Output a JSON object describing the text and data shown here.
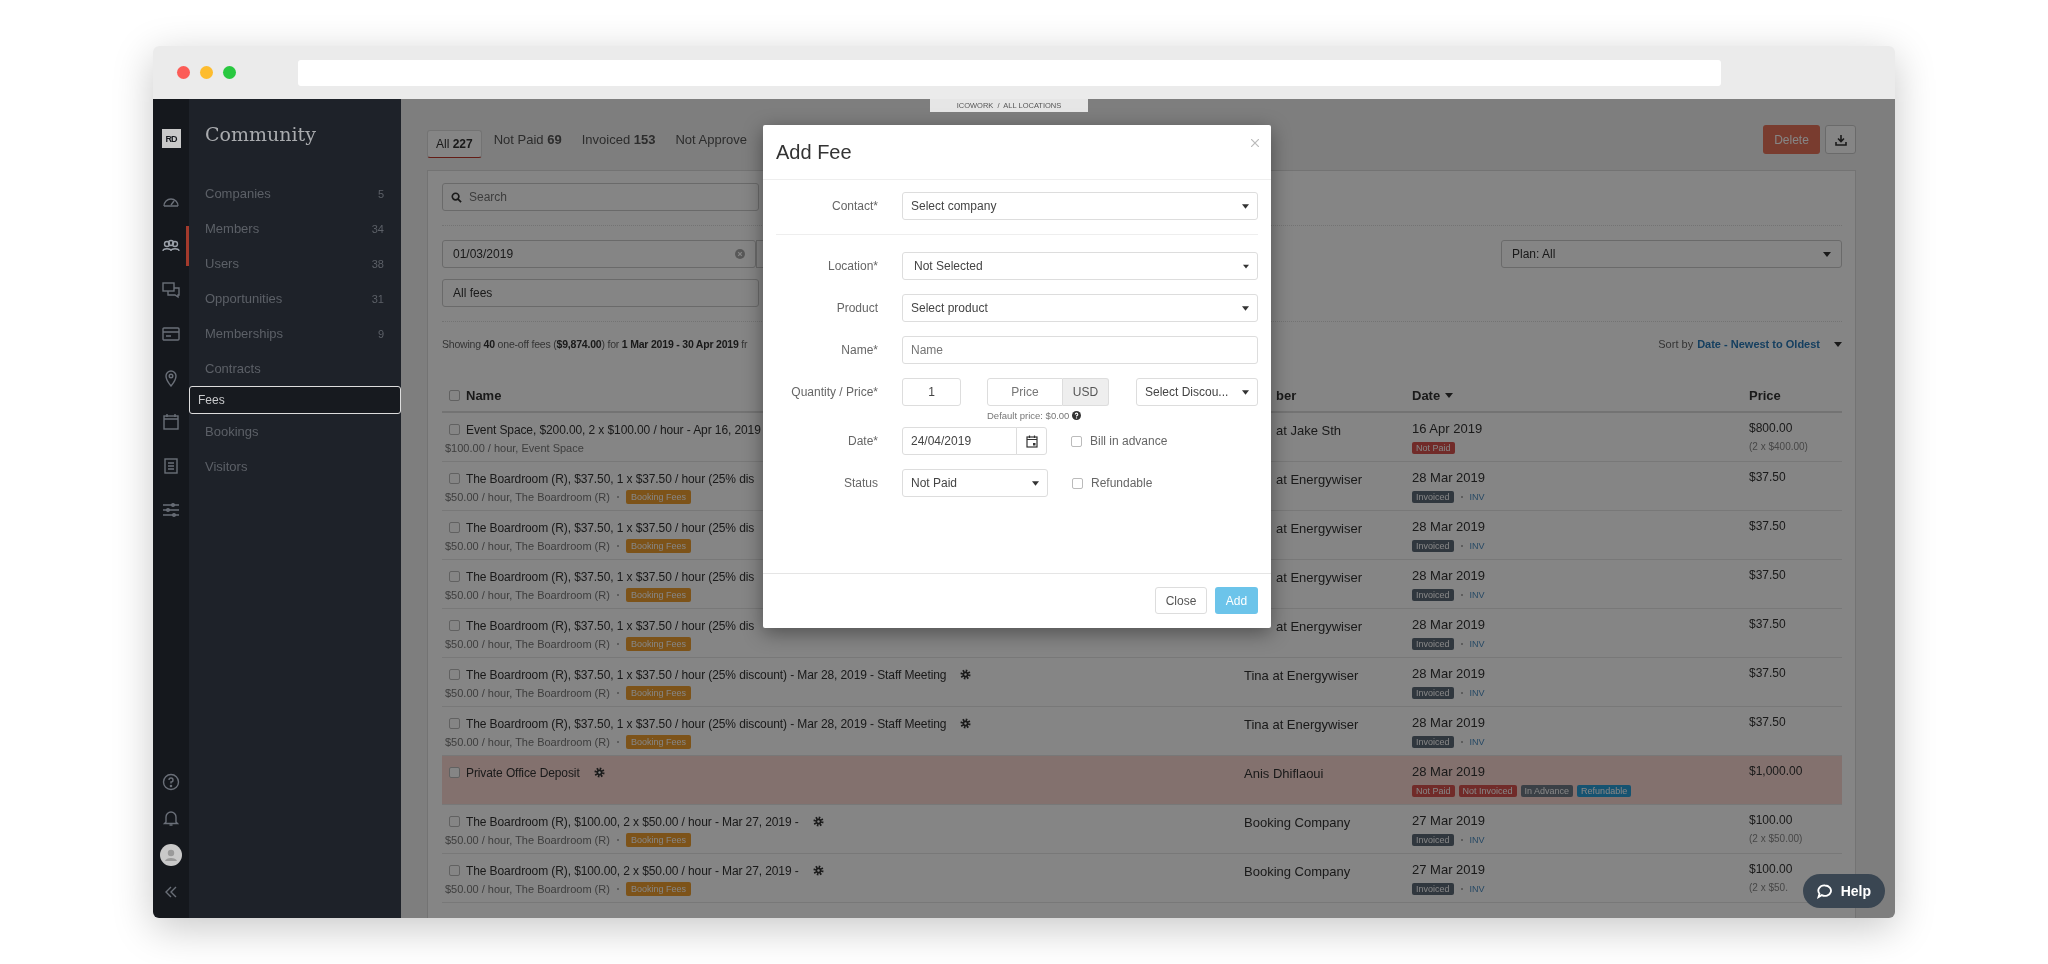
{
  "breadcrumb": "ICOWORK  /  ALL LOCATIONS",
  "rail": {
    "logo": "RD",
    "items": [
      {
        "kind": "gauge",
        "selected": false
      },
      {
        "kind": "people",
        "selected": true
      },
      {
        "kind": "chat",
        "selected": false
      },
      {
        "kind": "card",
        "selected": false
      },
      {
        "kind": "pin",
        "selected": false
      },
      {
        "kind": "calendar",
        "selected": false
      },
      {
        "kind": "document",
        "selected": false
      },
      {
        "kind": "sliders",
        "selected": false
      }
    ],
    "bottom": [
      {
        "kind": "help"
      },
      {
        "kind": "bell"
      },
      {
        "kind": "avatar"
      },
      {
        "kind": "collapse"
      }
    ]
  },
  "sidebar": {
    "title": "Community",
    "items": [
      {
        "label": "Companies",
        "count": "5",
        "selected": false
      },
      {
        "label": "Members",
        "count": "34",
        "selected": false
      },
      {
        "label": "Users",
        "count": "38",
        "selected": false
      },
      {
        "label": "Opportunities",
        "count": "31",
        "selected": false
      },
      {
        "label": "Memberships",
        "count": "9",
        "selected": false
      },
      {
        "label": "Contracts",
        "selected": false
      },
      {
        "label": "Fees",
        "selected": true
      },
      {
        "label": "Bookings",
        "selected": false
      },
      {
        "label": "Visitors",
        "selected": false
      }
    ]
  },
  "tabs": [
    {
      "label": "All",
      "count": "227",
      "selected": true
    },
    {
      "label": "Not Paid",
      "count": "69",
      "selected": false
    },
    {
      "label": "Invoiced",
      "count": "153",
      "selected": false
    },
    {
      "label": "Not Approve",
      "selected": false
    }
  ],
  "toolbar": {
    "delete": "Delete"
  },
  "filters": {
    "search": {
      "placeholder": "Search"
    },
    "date_from": {
      "value": "01/03/2019"
    },
    "fee_type": {
      "value": "All fees"
    },
    "plan": {
      "value": "Plan: All"
    }
  },
  "summary": "Showing **40** one-off fees (**$9,874.00**) for **1 Mar 2019 - 30 Apr 2019** fr",
  "sort": {
    "label": "Sort by",
    "value": "Date - Newest to Oldest"
  },
  "table": {
    "columns": [
      "Name",
      "ber",
      "Date",
      "Price"
    ],
    "all_checked": false,
    "rows": [
      {
        "name": "Event Space, $200.00, 2 x $100.00 / hour - Apr 16, 2019",
        "settings": false,
        "detail": "$100.00 / hour, Event Space",
        "checked": false,
        "highlighted": false,
        "member": "at Jake Sth",
        "date": "16 Apr 2019",
        "badges": [
          {
            "label": "Not Paid",
            "kind": "unpaid"
          }
        ],
        "price": "$800.00",
        "price_detail": "(2 x $400.00)"
      },
      {
        "name": "The Boardroom (R), $37.50, 1 x $37.50 / hour (25% dis",
        "settings": false,
        "detail": "$50.00 / hour, The Boardroom (R)",
        "tag": "Booking Fees",
        "checked": false,
        "highlighted": false,
        "member": "at Energywiser",
        "date": "28 Mar 2019",
        "badges": [
          {
            "label": "Invoiced",
            "kind": "invoiced"
          }
        ],
        "reference": "INV",
        "price": "$37.50"
      },
      {
        "name": "The Boardroom (R), $37.50, 1 x $37.50 / hour (25% dis",
        "settings": false,
        "detail": "$50.00 / hour, The Boardroom (R)",
        "tag": "Booking Fees",
        "checked": false,
        "highlighted": false,
        "member": "at Energywiser",
        "date": "28 Mar 2019",
        "badges": [
          {
            "label": "Invoiced",
            "kind": "invoiced"
          }
        ],
        "reference": "INV",
        "price": "$37.50"
      },
      {
        "name": "The Boardroom (R), $37.50, 1 x $37.50 / hour (25% dis",
        "settings": false,
        "detail": "$50.00 / hour, The Boardroom (R)",
        "tag": "Booking Fees",
        "checked": false,
        "highlighted": false,
        "member": "at Energywiser",
        "date": "28 Mar 2019",
        "badges": [
          {
            "label": "Invoiced",
            "kind": "invoiced"
          }
        ],
        "reference": "INV",
        "price": "$37.50"
      },
      {
        "name": "The Boardroom (R), $37.50, 1 x $37.50 / hour (25% dis",
        "settings": false,
        "detail": "$50.00 / hour, The Boardroom (R)",
        "tag": "Booking Fees",
        "checked": false,
        "highlighted": false,
        "member": "at Energywiser",
        "date": "28 Mar 2019",
        "badges": [
          {
            "label": "Invoiced",
            "kind": "invoiced"
          }
        ],
        "reference": "INV",
        "price": "$37.50"
      },
      {
        "name": "The Boardroom (R), $37.50, 1 x $37.50 / hour (25% discount) - Mar 28, 2019 - Staff Meeting",
        "settings": true,
        "detail": "$50.00 / hour, The Boardroom (R)",
        "tag": "Booking Fees",
        "checked": false,
        "highlighted": false,
        "member": "Tina at Energywiser",
        "date": "28 Mar 2019",
        "badges": [
          {
            "label": "Invoiced",
            "kind": "invoiced"
          }
        ],
        "reference": "INV",
        "price": "$37.50"
      },
      {
        "name": "The Boardroom (R), $37.50, 1 x $37.50 / hour (25% discount) - Mar 28, 2019 - Staff Meeting",
        "settings": true,
        "detail": "$50.00 / hour, The Boardroom (R)",
        "tag": "Booking Fees",
        "checked": false,
        "highlighted": false,
        "member": "Tina at Energywiser",
        "date": "28 Mar 2019",
        "badges": [
          {
            "label": "Invoiced",
            "kind": "invoiced"
          }
        ],
        "reference": "INV",
        "price": "$37.50"
      },
      {
        "name": "Private Office Deposit",
        "settings": true,
        "checked": false,
        "highlighted": true,
        "member": "Anis Dhiflaoui",
        "date": "28 Mar 2019",
        "badges": [
          {
            "label": "Not Paid",
            "kind": "unpaid"
          },
          {
            "label": "Not Invoiced",
            "kind": "unpaid"
          },
          {
            "label": "In Advance",
            "kind": "advance"
          },
          {
            "label": "Refundable",
            "kind": "refundable"
          }
        ],
        "price": "$1,000.00"
      },
      {
        "name": "The Boardroom (R), $100.00, 2 x $50.00 / hour - Mar 27, 2019 -",
        "settings": true,
        "detail": "$50.00 / hour, The Boardroom (R)",
        "tag": "Booking Fees",
        "checked": false,
        "highlighted": false,
        "member": "Booking Company",
        "date": "27 Mar 2019",
        "badges": [
          {
            "label": "Invoiced",
            "kind": "invoiced"
          }
        ],
        "reference": "INV",
        "price": "$100.00",
        "price_detail": "(2 x $50.00)"
      },
      {
        "name": "The Boardroom (R), $100.00, 2 x $50.00 / hour - Mar 27, 2019 -",
        "settings": true,
        "detail": "$50.00 / hour, The Boardroom (R)",
        "tag": "Booking Fees",
        "checked": false,
        "highlighted": false,
        "member": "Booking Company",
        "date": "27 Mar 2019",
        "badges": [
          {
            "label": "Invoiced",
            "kind": "invoiced"
          }
        ],
        "reference": "INV",
        "price": "$100.00",
        "price_detail": "(2 x $50."
      }
    ]
  },
  "dialog": {
    "title": "Add Fee",
    "contact": {
      "label": "Contact*",
      "value": "Select company"
    },
    "location": {
      "label": "Location*",
      "value": "Not Selected"
    },
    "product": {
      "label": "Product",
      "value": "Select product"
    },
    "name": {
      "label": "Name*",
      "placeholder": "Name"
    },
    "quantity_price": {
      "label": "Quantity / Price*",
      "quantity": "1",
      "price_placeholder": "Price",
      "currency": "USD",
      "discount": "Select Discou...",
      "hint": "Default price: $0.00"
    },
    "date": {
      "label": "Date*",
      "value": "24/04/2019"
    },
    "bill_in_advance": {
      "label": "Bill in advance",
      "checked": false
    },
    "status": {
      "label": "Status",
      "value": "Not Paid"
    },
    "refundable": {
      "label": "Refundable",
      "checked": false
    },
    "buttons": {
      "close": "Close",
      "add": "Add"
    }
  },
  "help_button": "Help"
}
